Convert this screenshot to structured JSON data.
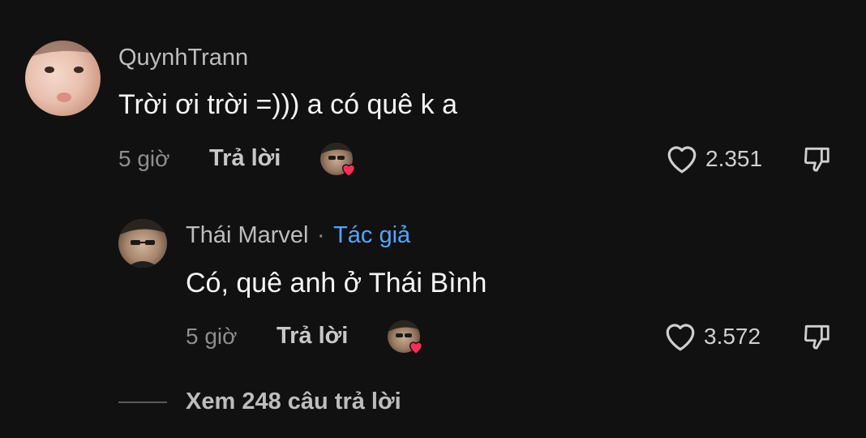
{
  "comments": [
    {
      "username": "QuynhTrann",
      "text": "Trời ơi trời =))) a có quê k a",
      "time": "5 giờ",
      "reply_label": "Trả lời",
      "likes": "2.351"
    }
  ],
  "reply": {
    "username": "Thái Marvel",
    "separator": "·",
    "author_tag": "Tác giả",
    "text": "Có, quê anh ở Thái Bình",
    "time": "5 giờ",
    "reply_label": "Trả lời",
    "likes": "3.572"
  },
  "view_more": "Xem 248 câu trả lời",
  "colors": {
    "background": "#111111",
    "author_tag": "#4ea7ff",
    "heart": "#fe2c55"
  },
  "icons": [
    "heart-outline-icon",
    "dislike-icon",
    "liked-by-creator-heart-icon"
  ]
}
